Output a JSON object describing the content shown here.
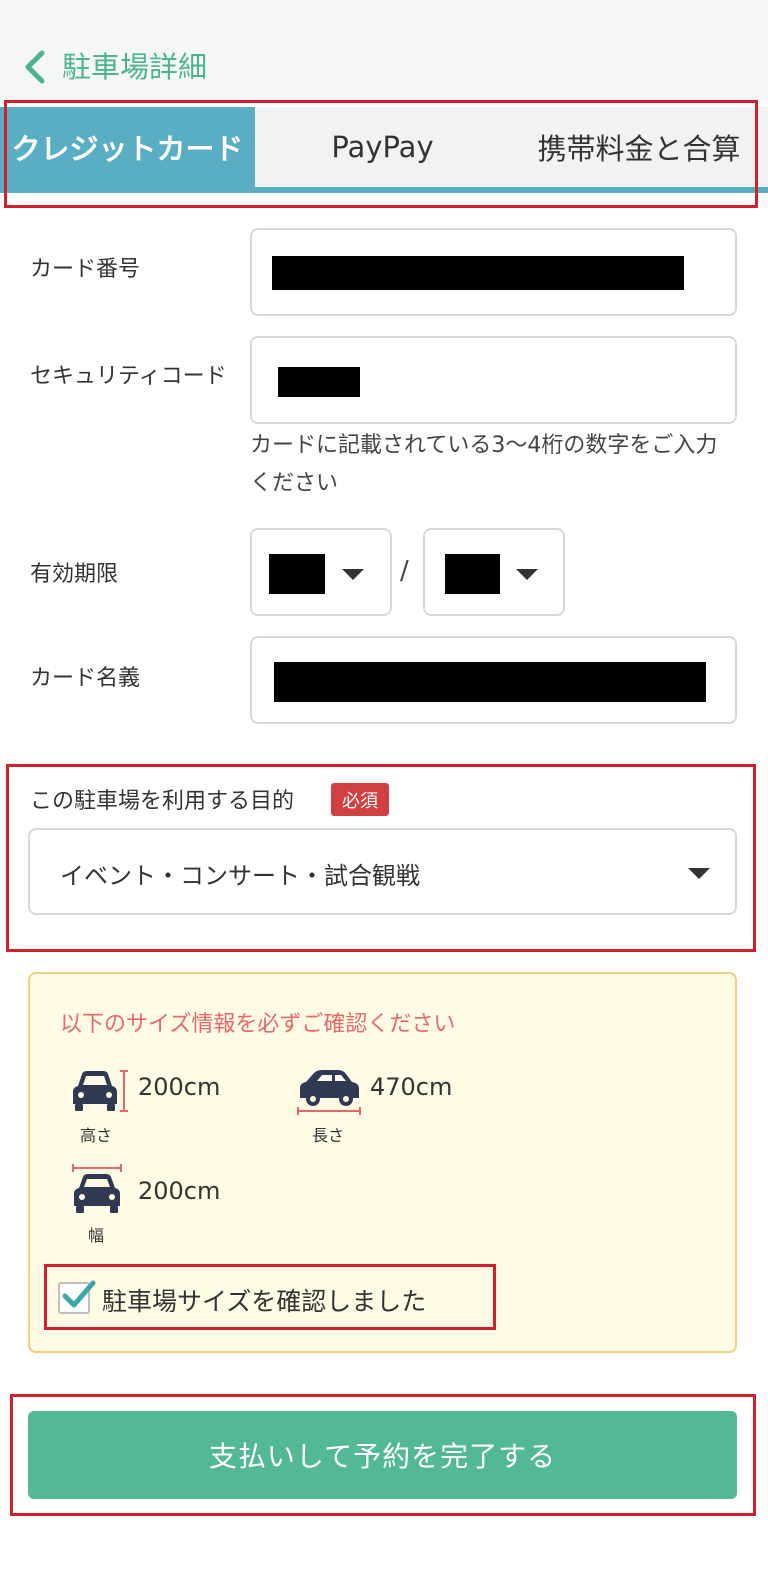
{
  "header": {
    "title": "駐車場詳細"
  },
  "tabs": [
    {
      "label": "クレジットカード"
    },
    {
      "label": "PayPay"
    },
    {
      "label": "携帯料金と合算"
    }
  ],
  "form": {
    "card_number_label": "カード番号",
    "security_code_label": "セキュリティコード",
    "security_code_hint": "カードに記載されている3〜4桁の数字をご入力ください",
    "expiry_label": "有効期限",
    "expiry_separator": "/",
    "card_holder_label": "カード名義"
  },
  "purpose": {
    "label": "この駐車場を利用する目的",
    "required_badge": "必須",
    "selected_value": "イベント・コンサート・試合観戦"
  },
  "size_info": {
    "title": "以下のサイズ情報を必ずご確認ください",
    "height": {
      "value": "200cm",
      "caption": "高さ"
    },
    "length": {
      "value": "470cm",
      "caption": "長さ"
    },
    "width": {
      "value": "200cm",
      "caption": "幅"
    },
    "confirm_label": "駐車場サイズを確認しました",
    "confirmed": true
  },
  "pay_button": {
    "label": "支払いして予約を完了する"
  },
  "colors": {
    "accent_green": "#52b994",
    "tab_active": "#5aaec4",
    "highlight_red": "#d0202d",
    "required_red": "#d04040",
    "notice_pink": "#e36a6a"
  }
}
